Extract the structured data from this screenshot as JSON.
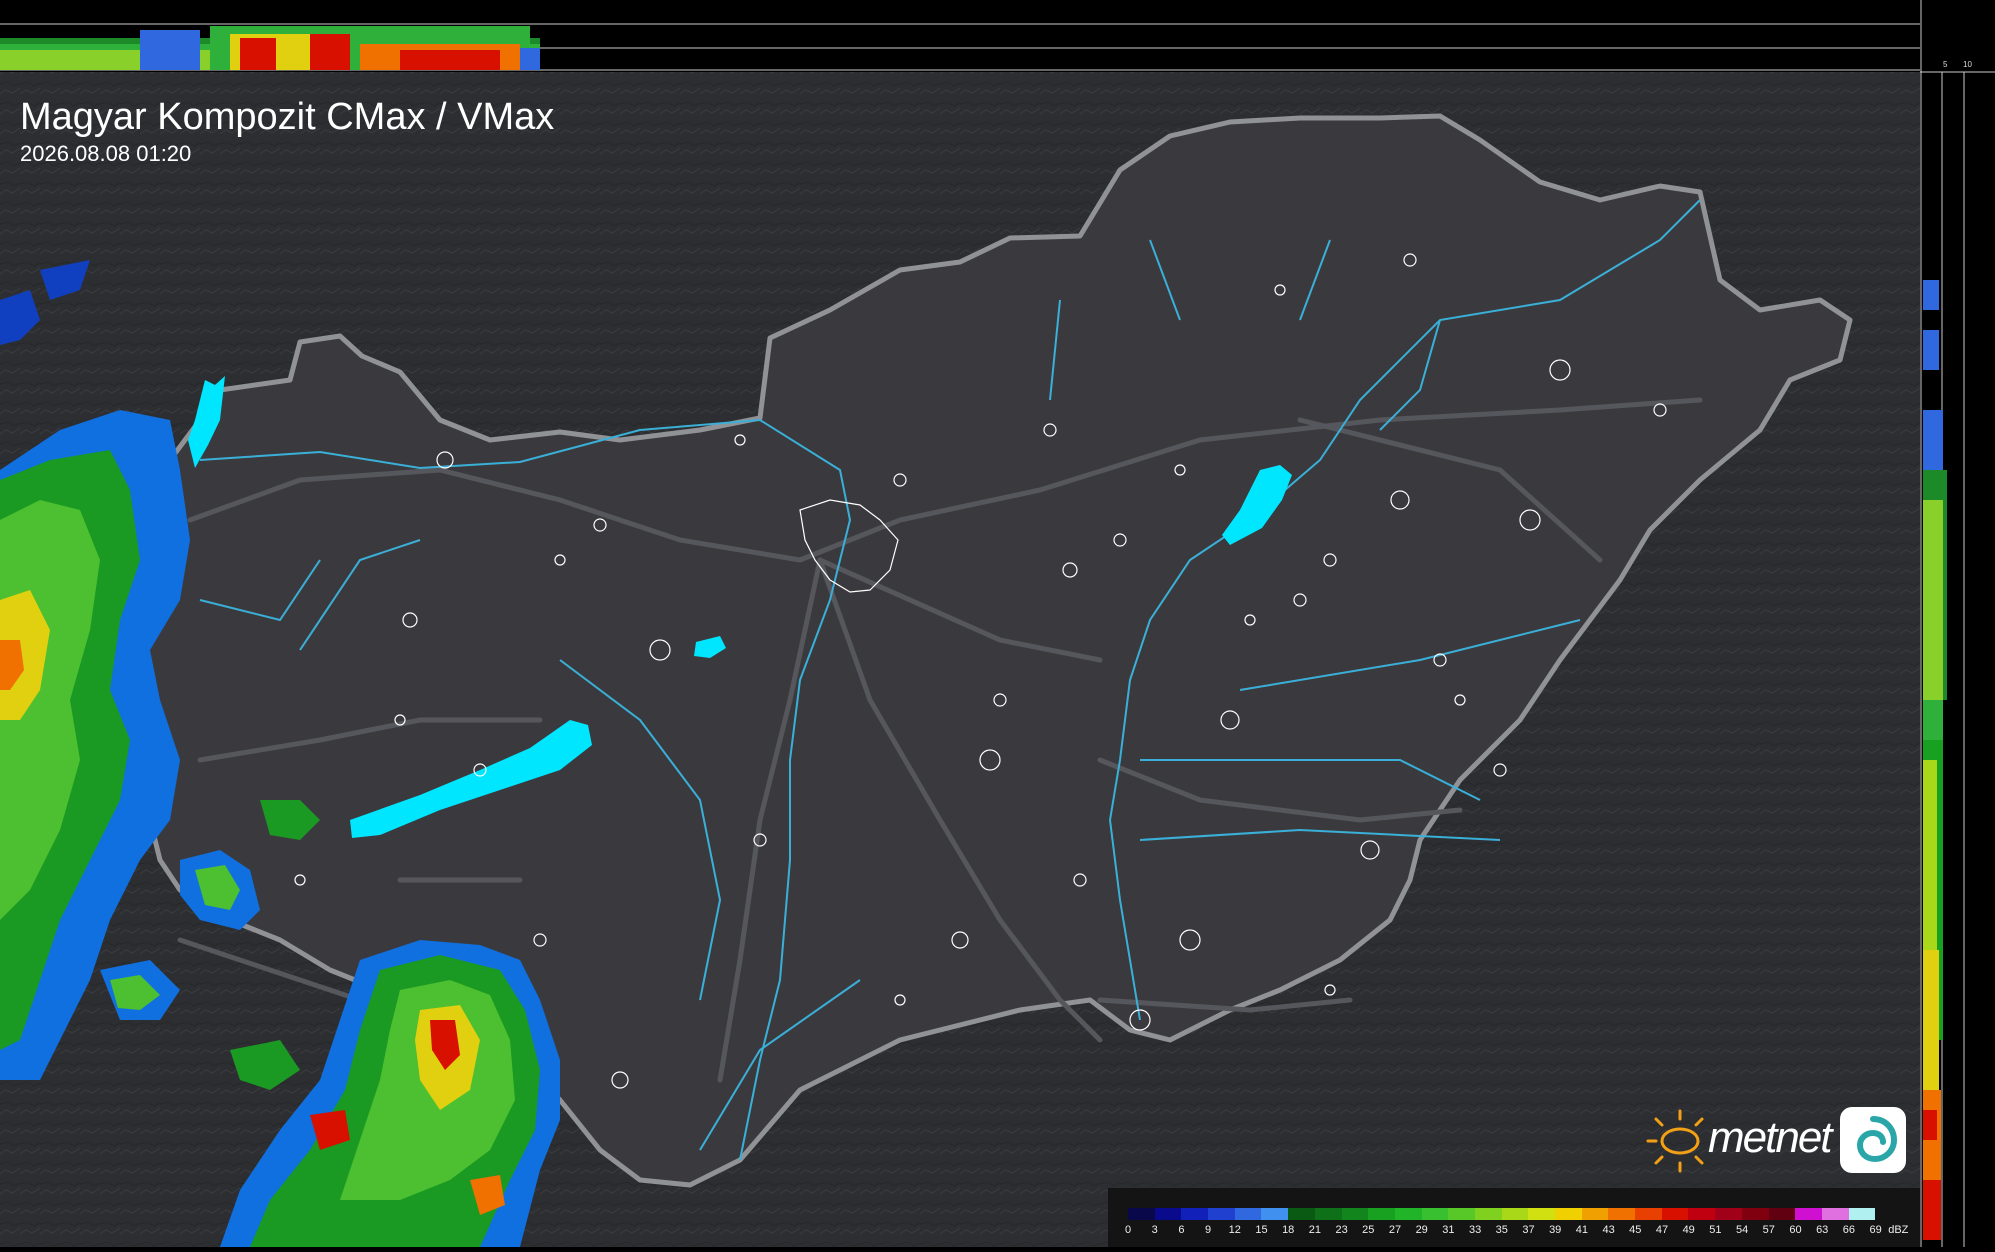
{
  "header": {
    "title": "Magyar Kompozit CMax / VMax",
    "timestamp": "2026.08.08 01:20"
  },
  "profile_scales": {
    "top": [
      "10",
      "5"
    ],
    "right": [
      "5",
      "10"
    ]
  },
  "logo": {
    "brand": "metnet",
    "sun_icon": "sun-icon",
    "badge_icon": "swirl-icon",
    "brand_color": "#f2a016"
  },
  "legend": {
    "unit": "dBZ",
    "labels": [
      "0",
      "3",
      "6",
      "9",
      "12",
      "15",
      "18",
      "21",
      "23",
      "25",
      "27",
      "29",
      "31",
      "33",
      "35",
      "37",
      "39",
      "41",
      "43",
      "45",
      "47",
      "49",
      "51",
      "54",
      "57",
      "60",
      "63",
      "66",
      "69"
    ],
    "colors": [
      "#08084a",
      "#0a0a8c",
      "#1020b8",
      "#2040d0",
      "#3068e0",
      "#4090f0",
      "#0a5a14",
      "#0e7018",
      "#12861c",
      "#18a020",
      "#22b428",
      "#38c030",
      "#58c828",
      "#80d020",
      "#a8d818",
      "#d0e010",
      "#f0d000",
      "#f0a000",
      "#f07000",
      "#e84000",
      "#d81000",
      "#c00010",
      "#a00018",
      "#800010",
      "#600010",
      "#d010d0",
      "#e070e0",
      "#b0f0f0"
    ]
  },
  "colors": {
    "land": "#2d2e31",
    "hungary_fill": "#3a3a3e",
    "border": "#909296",
    "river": "#3ab0d8",
    "lake": "#00e6ff",
    "city_outline": "#ffffff"
  }
}
